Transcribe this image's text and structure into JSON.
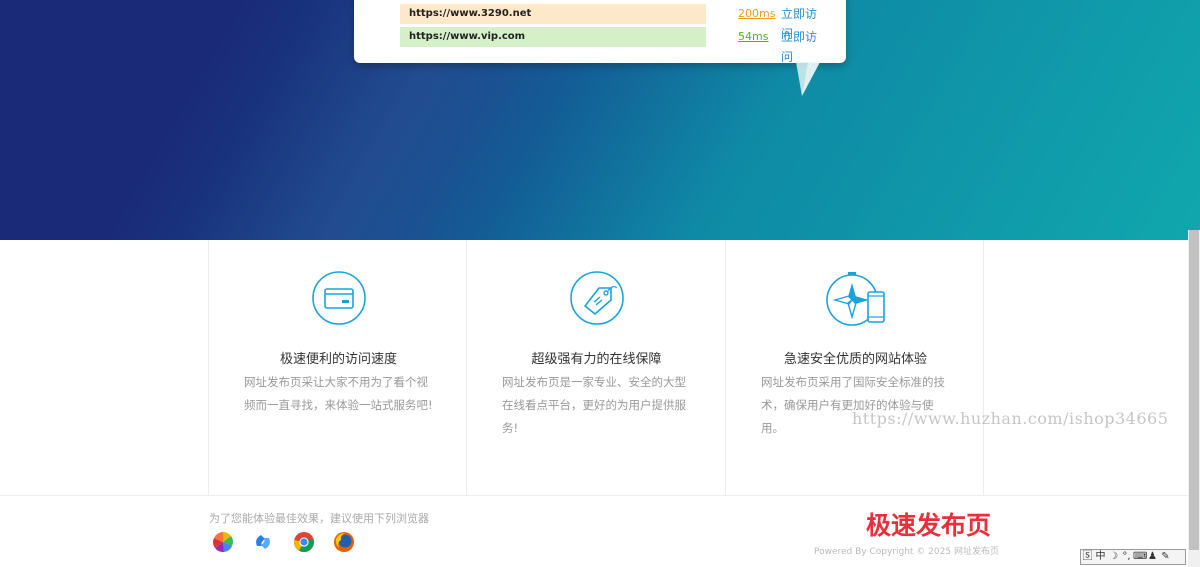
{
  "urls": [
    {
      "url": "https://www.3290.net",
      "latency": "200ms",
      "action": "立即访问"
    },
    {
      "url": "https://www.vip.com",
      "latency": "54ms",
      "action": "立即访问"
    }
  ],
  "features": [
    {
      "title": "极速便利的访问速度",
      "desc": "网址发布页采让大家不用为了看个视频而一直寻找，来体验一站式服务吧!",
      "icon": "card-icon"
    },
    {
      "title": "超级强有力的在线保障",
      "desc": "网址发布页是一家专业、安全的大型在线看点平台，更好的为用户提供服务!",
      "icon": "tag-icon"
    },
    {
      "title": "急速安全优质的网站体验",
      "desc": "网址发布页采用了国际安全标准的技术，确保用户有更加好的体验与使用。",
      "icon": "compass-phone-icon"
    }
  ],
  "footer": {
    "browser_tip": "为了您能体验最佳效果，建议使用下列浏览器",
    "brand": "极速发布页",
    "copyright": "Powered By Copyright © 2025 网址发布页"
  },
  "watermark": "https://www.huzhan.com/ishop34665",
  "ime": {
    "chars": [
      "中",
      "☽",
      "°,",
      "⌨",
      "♟",
      "✎"
    ]
  },
  "colors": {
    "accent_blue": "#2a8fd6",
    "icon_cyan": "#1aa3d9",
    "brand_red": "#e8303b",
    "latency_slow": "#f39c12",
    "latency_fast": "#58b02a"
  }
}
